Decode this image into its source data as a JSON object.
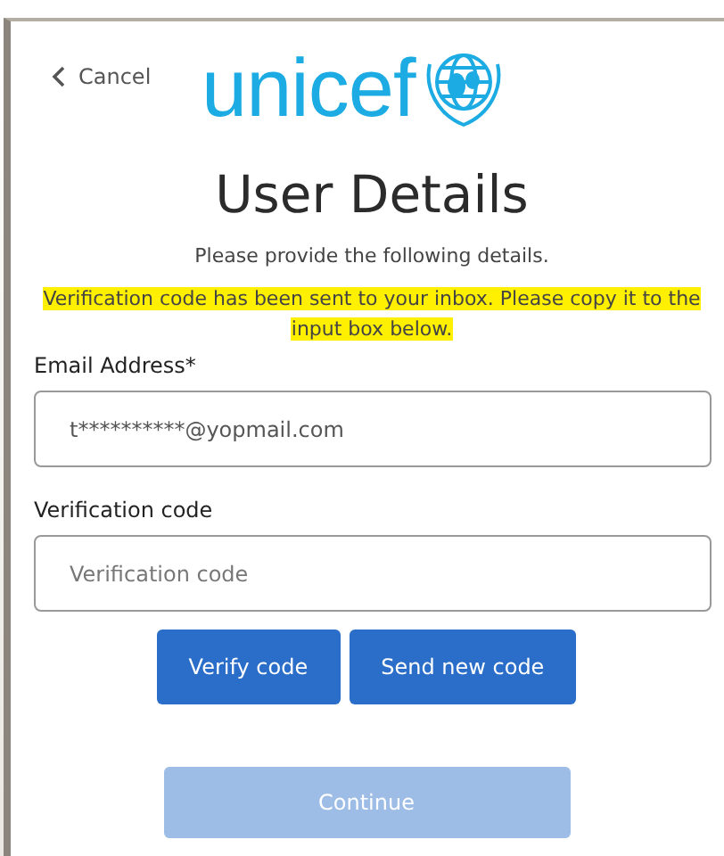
{
  "cancel_link": {
    "label": "Cancel"
  },
  "logo": {
    "wordmark": "unicef"
  },
  "title": "User Details",
  "subtitle": "Please provide the following details.",
  "notice": {
    "text": "Verification code has been sent to your inbox. Please copy it to the input box below.",
    "highlighted": true
  },
  "fields": [
    {
      "label": "Email Address*",
      "value": "t**********@yopmail.com"
    },
    {
      "label": "Verification code",
      "placeholder": "Verification code"
    }
  ],
  "buttons": [
    {
      "label": "Verify code",
      "disabled": false
    },
    {
      "label": "Send new code",
      "disabled": false
    }
  ],
  "continue_button": {
    "label": "Continue",
    "disabled": true
  }
}
